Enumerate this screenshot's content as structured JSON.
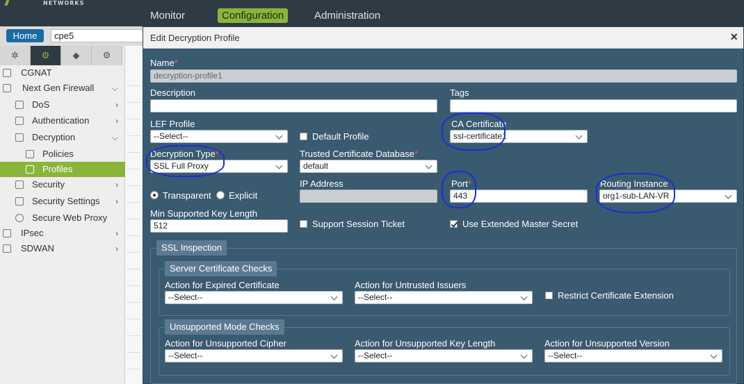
{
  "top_nav": {
    "logo_text": "NETWORKS",
    "tabs": [
      "Monitor",
      "Configuration",
      "Administration"
    ],
    "active_tab": "Configuration"
  },
  "breadcrumb": {
    "home_label": "Home",
    "device": "cpe5"
  },
  "sidebar": {
    "tab_icons": [
      "network-icon",
      "gear-icon",
      "cube-icon",
      "settings-globe-icon"
    ],
    "items": [
      {
        "label": "CGNAT",
        "icon": "cgnat-icon",
        "expandable": false
      },
      {
        "label": "Next Gen Firewall",
        "icon": "firewall-icon",
        "expandable": true,
        "expanded": true
      },
      {
        "label": "DoS",
        "icon": "dos-icon",
        "expandable": true
      },
      {
        "label": "Authentication",
        "icon": "authentication-icon",
        "expandable": true
      },
      {
        "label": "Decryption",
        "icon": "lock-icon",
        "expandable": true,
        "expanded": true
      },
      {
        "label": "Policies",
        "icon": "policy-icon",
        "expandable": false
      },
      {
        "label": "Profiles",
        "icon": "profiles-icon",
        "expandable": false,
        "selected": true
      },
      {
        "label": "Security",
        "icon": "security-icon",
        "expandable": true
      },
      {
        "label": "Security Settings",
        "icon": "shield-icon",
        "expandable": true
      },
      {
        "label": "Secure Web Proxy",
        "icon": "globe-icon",
        "expandable": false
      },
      {
        "label": "IPsec",
        "icon": "ipsec-icon",
        "expandable": true
      },
      {
        "label": "SDWAN",
        "icon": "sdwan-icon",
        "expandable": true
      }
    ]
  },
  "modal": {
    "title": "Edit Decryption Profile",
    "close_glyph": "×",
    "required_mark": "*",
    "name": {
      "label": "Name",
      "value": "decryption-profile1"
    },
    "description": {
      "label": "Description",
      "value": ""
    },
    "tags": {
      "label": "Tags",
      "value": ""
    },
    "lef_profile": {
      "label": "LEF Profile",
      "value": "--Select--"
    },
    "default_profile": {
      "label": "Default Profile",
      "checked": false
    },
    "ca_certificate": {
      "label": "CA Certificate",
      "value": "ssl-certificate1"
    },
    "decryption_type": {
      "label": "Decryption Type",
      "value": "SSL Full Proxy"
    },
    "trusted_cert_db": {
      "label": "Trusted Certificate Database",
      "value": "default"
    },
    "mode": {
      "transparent": "Transparent",
      "explicit": "Explicit",
      "selected": "Transparent"
    },
    "ip_address": {
      "label": "IP Address",
      "value": ""
    },
    "port": {
      "label": "Port",
      "value": "443"
    },
    "routing_instance": {
      "label": "Routing Instance",
      "value": "org1-sub-LAN-VR"
    },
    "min_key_length": {
      "label": "Min Supported Key Length",
      "value": "512"
    },
    "support_session_ticket": {
      "label": "Support Session Ticket",
      "checked": false
    },
    "use_extended_master_secret": {
      "label": "Use Extended Master Secret",
      "checked": true
    },
    "ssl_inspection": {
      "title": "SSL Inspection",
      "server_cert_checks": {
        "title": "Server Certificate Checks",
        "expired_cert": {
          "label": "Action for Expired Certificate",
          "value": "--Select--"
        },
        "untrusted_issuers": {
          "label": "Action for Untrusted Issuers",
          "value": "--Select--"
        },
        "restrict_cert_ext": {
          "label": "Restrict Certificate Extension",
          "checked": false
        }
      },
      "unsupported_mode_checks": {
        "title": "Unsupported Mode Checks",
        "cipher": {
          "label": "Action for Unsupported Cipher",
          "value": "--Select--"
        },
        "key_length": {
          "label": "Action for Unsupported Key Length",
          "value": "--Select--"
        },
        "version": {
          "label": "Action for Unsupported Version",
          "value": "--Select--"
        }
      }
    }
  },
  "colors": {
    "modal_bg": "#3a5a70",
    "accent_green": "#8ab53b",
    "annotation_blue": "#1a2fd6"
  }
}
